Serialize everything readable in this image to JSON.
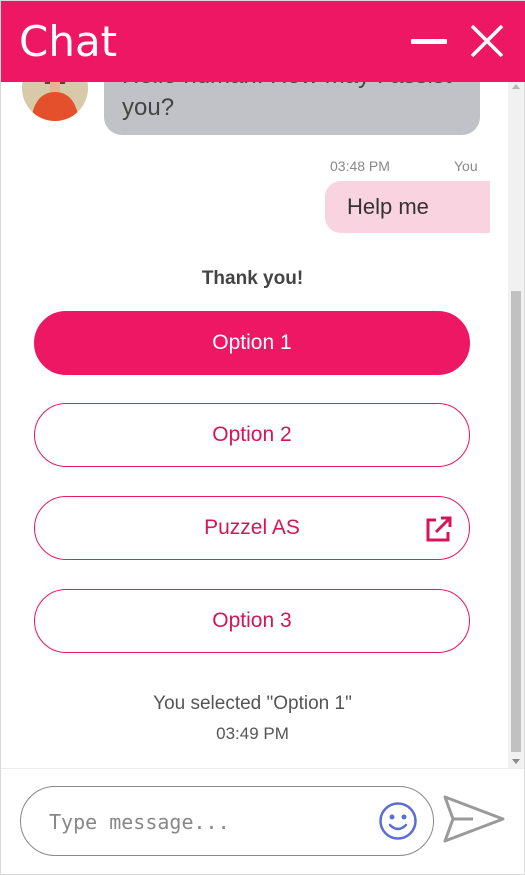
{
  "header": {
    "title": "Chat"
  },
  "messages": {
    "bot_message_line1": "Hello human. How may I assist",
    "bot_message_line2": "you?",
    "user_timestamp": "03:48 PM",
    "user_sender": "You",
    "user_message": "Help me"
  },
  "quick_replies": {
    "title": "Thank you!",
    "options": [
      {
        "label": "Option 1",
        "selected": true
      },
      {
        "label": "Option 2",
        "selected": false
      },
      {
        "label": "Puzzel AS",
        "selected": false,
        "external_link": true
      },
      {
        "label": "Option 3",
        "selected": false
      }
    ]
  },
  "selection": {
    "text": "You selected \"Option 1\"",
    "time": "03:49 PM"
  },
  "composer": {
    "placeholder": "Type message..."
  },
  "colors": {
    "accent": "#ee1763",
    "bot_bubble": "#c0c2c7",
    "user_bubble": "#fad3e1",
    "emoji_icon": "#5b6ed6"
  },
  "icons": {
    "minimize": "minimize-icon",
    "close": "close-icon",
    "external_link": "external-link-icon",
    "emoji": "emoji-icon",
    "send": "send-icon"
  }
}
